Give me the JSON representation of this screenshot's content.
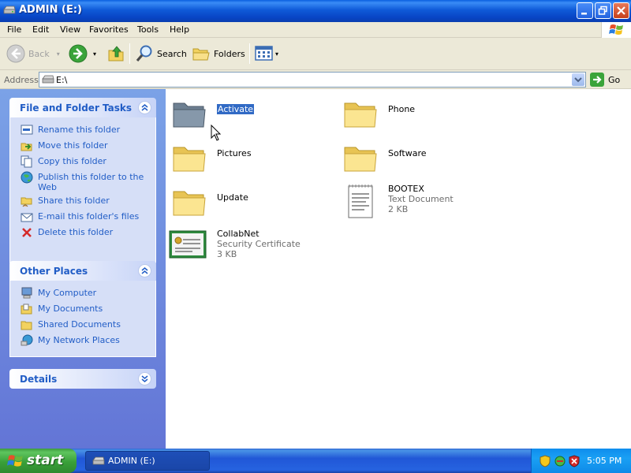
{
  "window": {
    "title": "ADMIN (E:)"
  },
  "menu": [
    "File",
    "Edit",
    "View",
    "Favorites",
    "Tools",
    "Help"
  ],
  "toolbar": {
    "back": "Back",
    "search": "Search",
    "folders": "Folders"
  },
  "address": {
    "label": "Address",
    "value": "E:\\",
    "go": "Go"
  },
  "tasks_panel": {
    "title": "File and Folder Tasks",
    "items": [
      "Rename this folder",
      "Move this folder",
      "Copy this folder",
      "Publish this folder to the Web",
      "Share this folder",
      "E-mail this folder's files",
      "Delete this folder"
    ]
  },
  "places_panel": {
    "title": "Other Places",
    "items": [
      "My Computer",
      "My Documents",
      "Shared Documents",
      "My Network Places"
    ]
  },
  "details_panel": {
    "title": "Details"
  },
  "files": [
    {
      "name": "Activate",
      "type": "folder",
      "selected": true
    },
    {
      "name": "Phone",
      "type": "folder"
    },
    {
      "name": "Pictures",
      "type": "folder"
    },
    {
      "name": "Software",
      "type": "folder"
    },
    {
      "name": "Update",
      "type": "folder"
    },
    {
      "name": "BOOTEX",
      "type": "text",
      "kind": "Text Document",
      "size": "2 KB"
    },
    {
      "name": "CollabNet",
      "type": "cert",
      "kind": "Security Certificate",
      "size": "3 KB"
    }
  ],
  "taskbar": {
    "start": "start",
    "window_button": "ADMIN (E:)",
    "clock": "5:05 PM"
  },
  "colors": {
    "title_blue": "#0a46c8",
    "link_blue": "#215dc6",
    "selection": "#316ac5",
    "start_green": "#3aa03a"
  }
}
